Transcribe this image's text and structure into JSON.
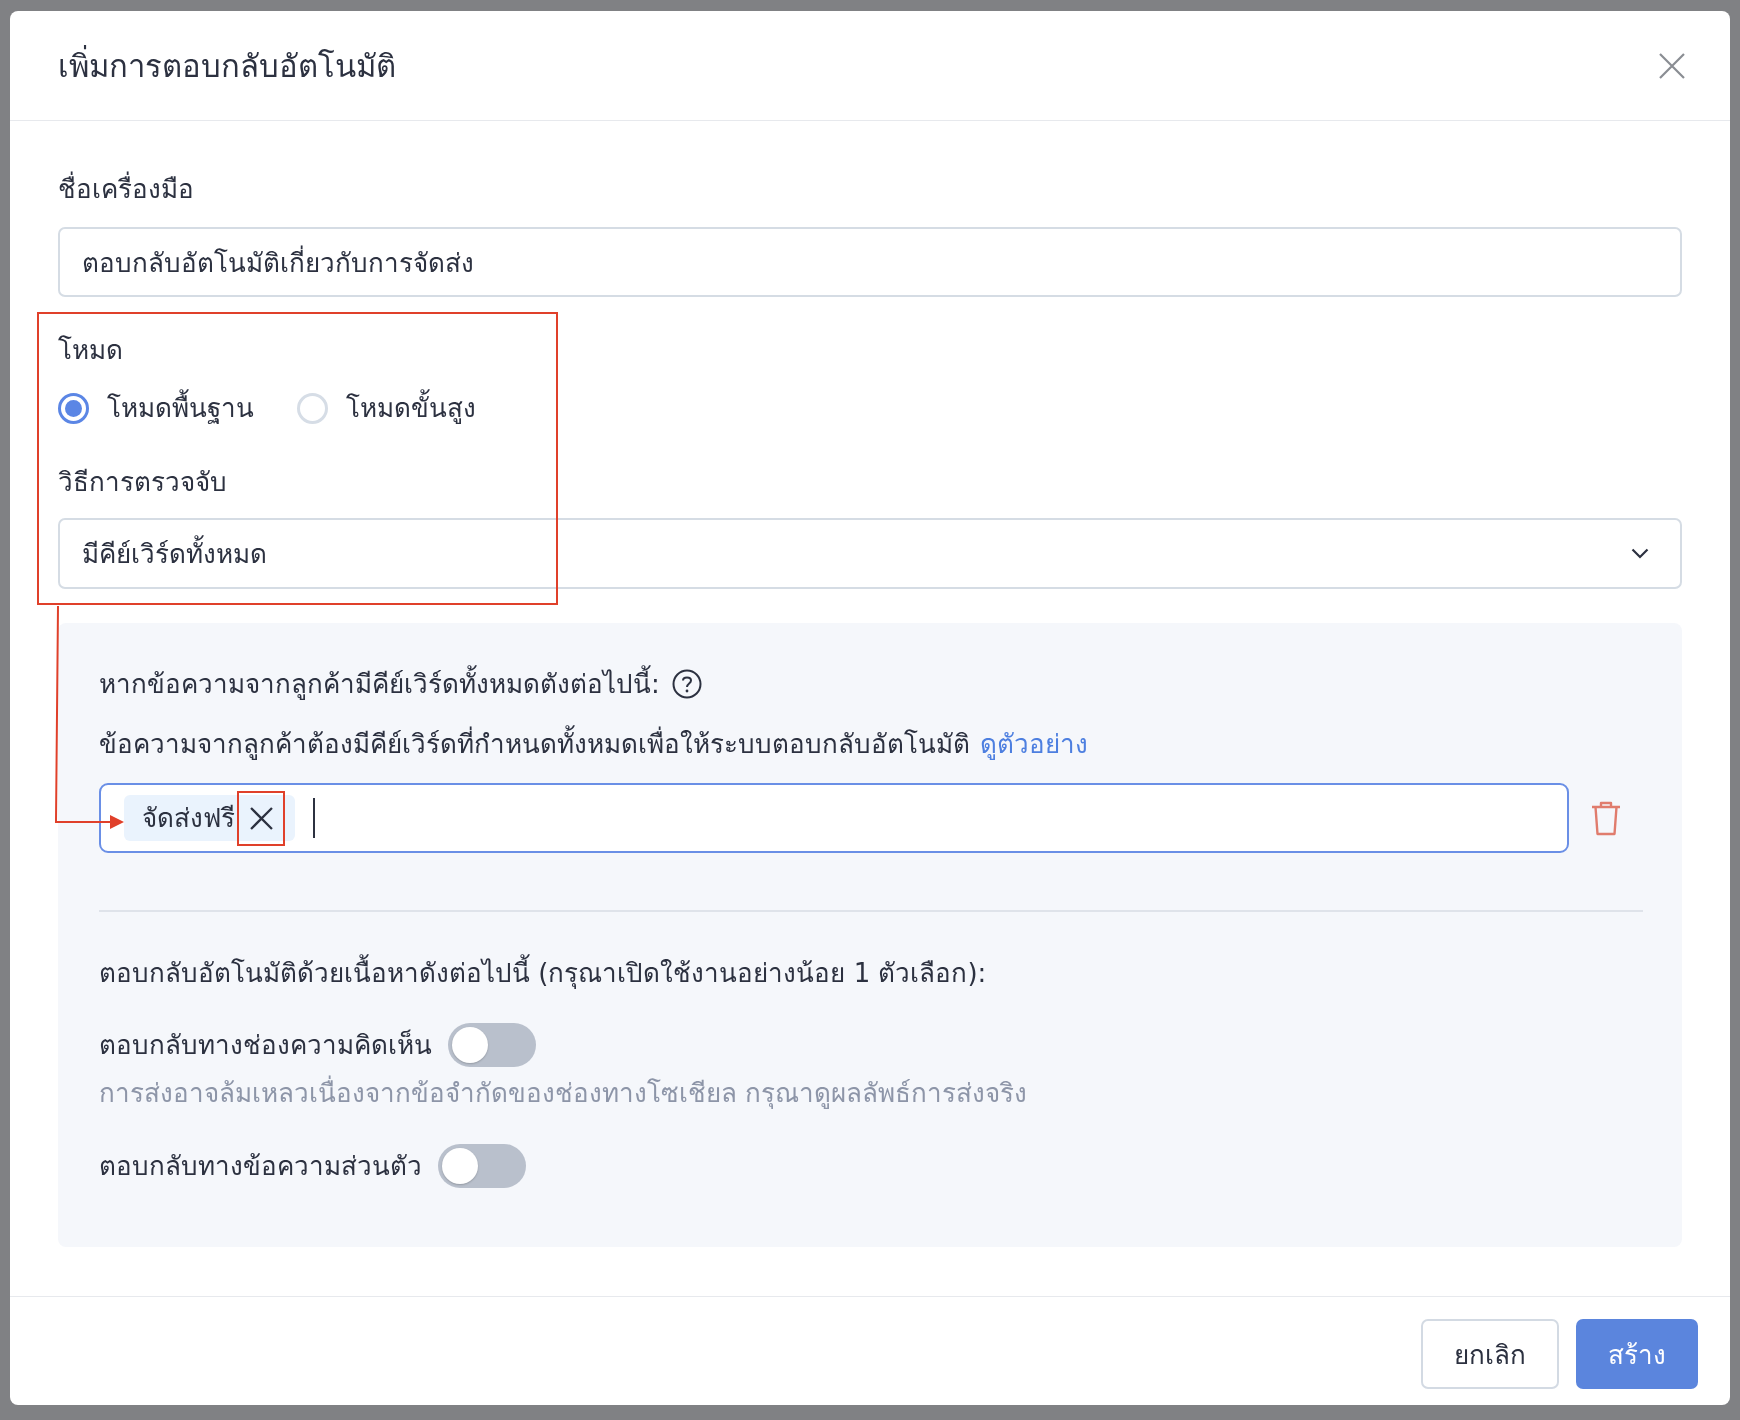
{
  "dialog": {
    "title": "เพิ่มการตอบกลับอัตโนมัติ"
  },
  "tool_name": {
    "label": "ชื่อเครื่องมือ",
    "value": "ตอบกลับอัตโนมัติเกี่ยวกับการจัดส่ง"
  },
  "settings": {
    "highlighted": true,
    "mode": {
      "label": "โหมด",
      "options": [
        {
          "label": "โหมดพื้นฐาน",
          "selected": true
        },
        {
          "label": "โหมดขั้นสูง",
          "selected": false
        }
      ]
    },
    "detection": {
      "label": "วิธีการตรวจจับ",
      "value": "มีคีย์เวิร์ดทั้งหมด"
    }
  },
  "condition_panel": {
    "heading": "หากข้อความจากลูกค้ามีคีย์เวิร์ดทั้งหมดตังต่อไปนี้:",
    "description": "ข้อความจากลูกค้าต้องมีคีย์เวิร์ดที่กำหนดทั้งหมดเพื่อให้ระบบตอบกลับอัตโนมัติ",
    "link": "ดูตัวอย่าง",
    "keyword_field": {
      "focused": true,
      "tags": [
        {
          "text": "จัดส่งฟรี",
          "remove_highlighted": true
        }
      ]
    }
  },
  "reply_options": {
    "heading": "ตอบกลับอัตโนมัติด้วยเนื้อหาดังต่อไปนี้ (กรุณาเปิดใช้งานอย่างน้อย 1 ตัวเลือก):",
    "items": [
      {
        "label": "ตอบกลับทางช่องความคิดเห็น",
        "on": false,
        "hint": "การส่งอาจล้มเหลวเนื่องจากข้อจำกัดของช่องทางโซเชียล กรุณาดูผลลัพธ์การส่งจริง"
      },
      {
        "label": "ตอบกลับทางข้อความส่วนตัว",
        "on": false
      }
    ]
  },
  "annotation_arrow": true,
  "buttons": [
    {
      "label": "ยกเลิก",
      "kind": "secondary"
    },
    {
      "label": "สร้าง",
      "kind": "primary"
    }
  ]
}
